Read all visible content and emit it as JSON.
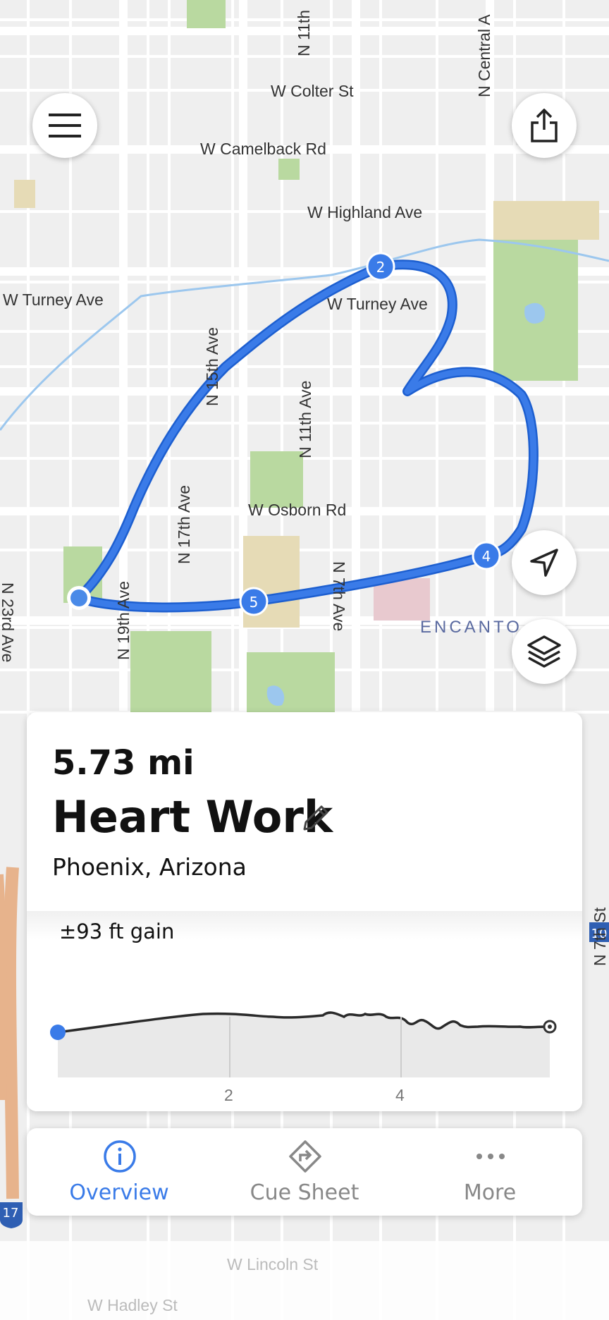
{
  "map": {
    "streets": [
      {
        "id": "w-colter",
        "label": "W Colter St"
      },
      {
        "id": "w-camelback",
        "label": "W Camelback Rd"
      },
      {
        "id": "w-highland",
        "label": "W Highland Ave"
      },
      {
        "id": "w-turney-left",
        "label": "W Turney Ave"
      },
      {
        "id": "w-turney-right",
        "label": "W Turney Ave"
      },
      {
        "id": "n-15th",
        "label": "N 15th Ave"
      },
      {
        "id": "n-11th",
        "label": "N 11th Ave"
      },
      {
        "id": "n-11th-top",
        "label": "N 11th"
      },
      {
        "id": "n-17th",
        "label": "N 17th Ave"
      },
      {
        "id": "w-osborn",
        "label": "W Osborn Rd"
      },
      {
        "id": "n-19th",
        "label": "N 19th Ave"
      },
      {
        "id": "n-7th",
        "label": "N 7th Ave"
      },
      {
        "id": "n-23rd",
        "label": "N 23rd Ave"
      },
      {
        "id": "n-central",
        "label": "N Central A"
      },
      {
        "id": "encanto",
        "label": "ENCANTO"
      },
      {
        "id": "n-7th-st",
        "label": "N 7th St"
      },
      {
        "id": "w-lincoln",
        "label": "W Lincoln St"
      },
      {
        "id": "w-hadley",
        "label": "W Hadley St"
      }
    ],
    "markers": [
      "2",
      "4",
      "5"
    ],
    "highways": [
      "10",
      "17"
    ]
  },
  "buttons": {
    "menu_icon": "hamburger-menu-icon",
    "share_icon": "share-icon",
    "locate_icon": "navigation-arrow-icon",
    "layers_icon": "layers-icon"
  },
  "route": {
    "distance": "5.73 mi",
    "name": "Heart Work",
    "location": "Phoenix, Arizona",
    "edit_icon": "pencil-icon"
  },
  "elevation": {
    "gain_label": "±93 ft gain",
    "x_ticks": [
      "2",
      "4"
    ],
    "total_distance_mi": 5.73
  },
  "tabs": [
    {
      "label": "Overview",
      "icon": "info-icon",
      "active": true
    },
    {
      "label": "Cue Sheet",
      "icon": "directions-icon",
      "active": false
    },
    {
      "label": "More",
      "icon": "more-dots-icon",
      "active": false
    }
  ],
  "colors": {
    "route": "#3a7be8",
    "active_tab": "#3a7be8",
    "inactive_tab": "#888888",
    "park": "#b9d9a0",
    "water": "#9cc7ee"
  }
}
